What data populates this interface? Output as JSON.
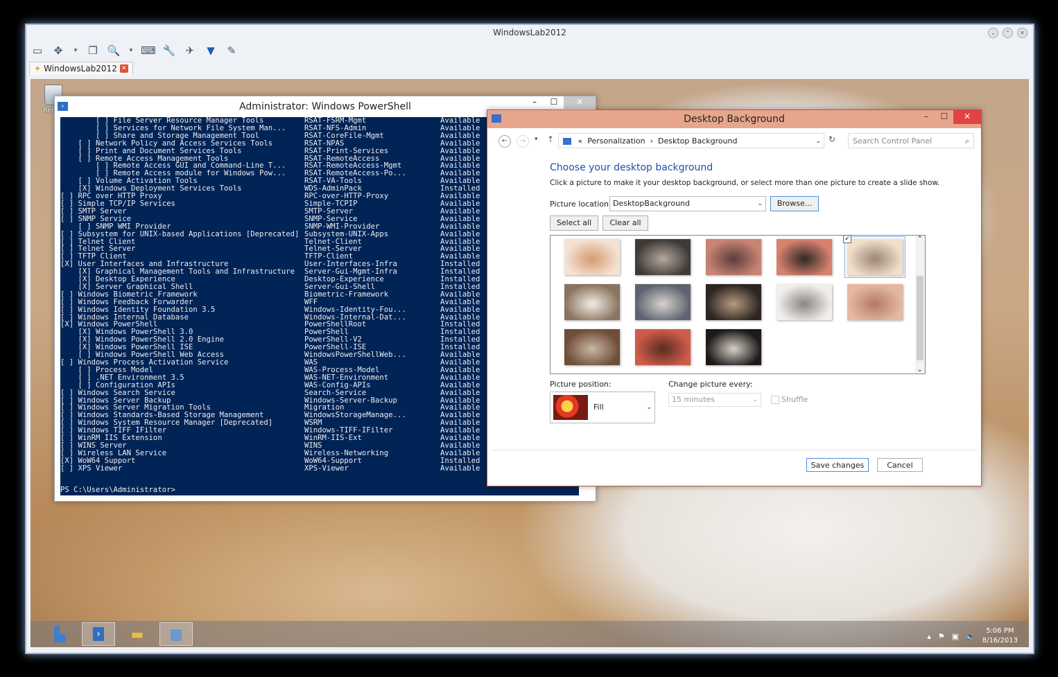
{
  "host": {
    "title": "WindowsLab2012",
    "tab_label": "WindowsLab2012",
    "toolbar_icons": [
      "screen-icon",
      "fullscreen-icon",
      "dropdown-icon",
      "copy-icon",
      "zoom-icon",
      "dropdown-icon",
      "keyboard-icon",
      "tools-icon",
      "send-icon",
      "filter-icon",
      "brush-icon"
    ]
  },
  "desktop": {
    "recycle_label": "Rec"
  },
  "powershell": {
    "title": "Administrator: Windows PowerShell",
    "rows": [
      [
        "        [ ] File Server Resource Manager Tools",
        "RSAT-FSRM-Mgmt",
        "Available"
      ],
      [
        "        [ ] Services for Network File System Man...",
        "RSAT-NFS-Admin",
        "Available"
      ],
      [
        "        [ ] Share and Storage Management Tool",
        "RSAT-CoreFile-Mgmt",
        "Available"
      ],
      [
        "    [ ] Network Policy and Access Services Tools",
        "RSAT-NPAS",
        "Available"
      ],
      [
        "    [ ] Print and Document Services Tools",
        "RSAT-Print-Services",
        "Available"
      ],
      [
        "    [ ] Remote Access Management Tools",
        "RSAT-RemoteAccess",
        "Available"
      ],
      [
        "        [ ] Remote Access GUI and Command-Line T...",
        "RSAT-RemoteAccess-Mgmt",
        "Available"
      ],
      [
        "        [ ] Remote Access module for Windows Pow...",
        "RSAT-RemoteAccess-Po...",
        "Available"
      ],
      [
        "    [ ] Volume Activation Tools",
        "RSAT-VA-Tools",
        "Available"
      ],
      [
        "    [X] Windows Deployment Services Tools",
        "WDS-AdminPack",
        "Installed"
      ],
      [
        "[ ] RPC over HTTP Proxy",
        "RPC-over-HTTP-Proxy",
        "Available"
      ],
      [
        "[ ] Simple TCP/IP Services",
        "Simple-TCPIP",
        "Available"
      ],
      [
        "[ ] SMTP Server",
        "SMTP-Server",
        "Available"
      ],
      [
        "[ ] SNMP Service",
        "SNMP-Service",
        "Available"
      ],
      [
        "    [ ] SNMP WMI Provider",
        "SNMP-WMI-Provider",
        "Available"
      ],
      [
        "[ ] Subsystem for UNIX-based Applications [Deprecated]",
        "Subsystem-UNIX-Apps",
        "Available"
      ],
      [
        "[ ] Telnet Client",
        "Telnet-Client",
        "Available"
      ],
      [
        "[ ] Telnet Server",
        "Telnet-Server",
        "Available"
      ],
      [
        "[ ] TFTP Client",
        "TFTP-Client",
        "Available"
      ],
      [
        "[X] User Interfaces and Infrastructure",
        "User-Interfaces-Infra",
        "Installed"
      ],
      [
        "    [X] Graphical Management Tools and Infrastructure",
        "Server-Gui-Mgmt-Infra",
        "Installed"
      ],
      [
        "    [X] Desktop Experience",
        "Desktop-Experience",
        "Installed"
      ],
      [
        "    [X] Server Graphical Shell",
        "Server-Gui-Shell",
        "Installed"
      ],
      [
        "[ ] Windows Biometric Framework",
        "Biometric-Framework",
        "Available"
      ],
      [
        "[ ] Windows Feedback Forwarder",
        "WFF",
        "Available"
      ],
      [
        "[ ] Windows Identity Foundation 3.5",
        "Windows-Identity-Fou...",
        "Available"
      ],
      [
        "[ ] Windows Internal Database",
        "Windows-Internal-Dat...",
        "Available"
      ],
      [
        "[X] Windows PowerShell",
        "PowerShellRoot",
        "Installed"
      ],
      [
        "    [X] Windows PowerShell 3.0",
        "PowerShell",
        "Installed"
      ],
      [
        "    [X] Windows PowerShell 2.0 Engine",
        "PowerShell-V2",
        "Installed"
      ],
      [
        "    [X] Windows PowerShell ISE",
        "PowerShell-ISE",
        "Installed"
      ],
      [
        "    [ ] Windows PowerShell Web Access",
        "WindowsPowerShellWeb...",
        "Available"
      ],
      [
        "[ ] Windows Process Activation Service",
        "WAS",
        "Available"
      ],
      [
        "    [ ] Process Model",
        "WAS-Process-Model",
        "Available"
      ],
      [
        "    [ ] .NET Environment 3.5",
        "WAS-NET-Environment",
        "Available"
      ],
      [
        "    [ ] Configuration APIs",
        "WAS-Config-APIs",
        "Available"
      ],
      [
        "[ ] Windows Search Service",
        "Search-Service",
        "Available"
      ],
      [
        "[ ] Windows Server Backup",
        "Windows-Server-Backup",
        "Available"
      ],
      [
        "[ ] Windows Server Migration Tools",
        "Migration",
        "Available"
      ],
      [
        "[ ] Windows Standards-Based Storage Management",
        "WindowsStorageManage...",
        "Available"
      ],
      [
        "[ ] Windows System Resource Manager [Deprecated]",
        "WSRM",
        "Available"
      ],
      [
        "[ ] Windows TIFF IFilter",
        "Windows-TIFF-IFilter",
        "Available"
      ],
      [
        "[ ] WinRM IIS Extension",
        "WinRM-IIS-Ext",
        "Available"
      ],
      [
        "[ ] WINS Server",
        "WINS",
        "Available"
      ],
      [
        "[ ] Wireless LAN Service",
        "Wireless-Networking",
        "Available"
      ],
      [
        "[X] WoW64 Support",
        "WoW64-Support",
        "Installed"
      ],
      [
        "[ ] XPS Viewer",
        "XPS-Viewer",
        "Available"
      ]
    ],
    "prompt": "PS C:\\Users\\Administrator>"
  },
  "control_panel": {
    "title": "Desktop Background",
    "breadcrumb": [
      "Personalization",
      "Desktop Background"
    ],
    "breadcrumb_prefix": "«",
    "search_placeholder": "Search Control Panel",
    "heading": "Choose your desktop background",
    "description": "Click a picture to make it your desktop background, or select more than one picture to create a slide show.",
    "picture_location_label": "Picture location:",
    "picture_location_value": "DesktopBackground",
    "browse_label": "Browse...",
    "select_all_label": "Select all",
    "clear_all_label": "Clear all",
    "picture_position_label": "Picture position:",
    "picture_position_value": "Fill",
    "change_every_label": "Change picture every:",
    "change_every_value": "15 minutes",
    "shuffle_label": "Shuffle",
    "save_label": "Save changes",
    "cancel_label": "Cancel",
    "thumbnail_count": 13,
    "selected_thumbnail": 5
  },
  "taskbar": {
    "apps": [
      "server-manager-icon",
      "powershell-icon",
      "file-explorer-icon",
      "control-panel-icon"
    ],
    "time": "5:06 PM",
    "date": "8/16/2013"
  }
}
